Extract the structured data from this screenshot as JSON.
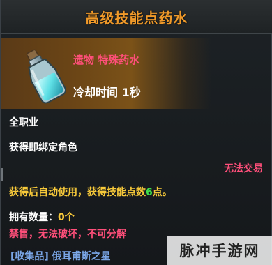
{
  "item": {
    "title": "高级技能点药水",
    "category": "遗物 特殊药水",
    "cooldown": "冷却时间 1秒",
    "job": "全职业",
    "bind": "获得即绑定角色",
    "trade": "无法交易",
    "usage_prefix": "获得后自动使用，获得技能点数",
    "usage_count": "6",
    "usage_suffix": "点。",
    "owned_label": "拥有数量：",
    "owned_value": "0个",
    "restrictions": "禁售，无法破坏，不可分解",
    "collection": "[收集品] 俄耳甫斯之星",
    "icon": "potion-bottle-icon"
  },
  "watermark": {
    "text": "脉冲手游网"
  },
  "colors": {
    "title": "#f09a2a",
    "category": "#ff4f7a",
    "usage": "#f7c93a",
    "count": "#3fe04b",
    "collection": "#7aa6e6"
  }
}
